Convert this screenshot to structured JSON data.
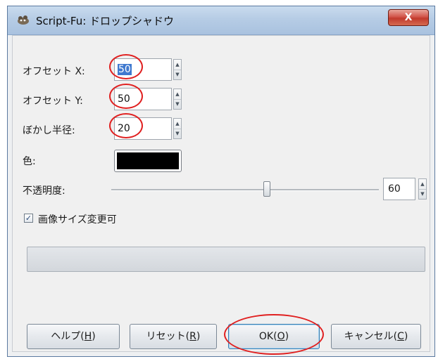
{
  "window": {
    "title": "Script-Fu: ドロップシャドウ",
    "close_label": "X",
    "app_icon": "gimp-icon"
  },
  "fields": {
    "offset_x": {
      "label": "オフセット X:",
      "value": "50"
    },
    "offset_y": {
      "label": "オフセット Y:",
      "value": "50"
    },
    "blur_radius": {
      "label": "ぼかし半径:",
      "value": "20"
    },
    "color": {
      "label": "色:",
      "value": "#000000"
    },
    "opacity": {
      "label": "不透明度:",
      "value": "60",
      "slider_fraction": 0.6
    },
    "allow_resize": {
      "label": "画像サイズ変更可",
      "checked": true
    }
  },
  "buttons": {
    "help": {
      "text": "ヘルプ(",
      "mnemonic": "H",
      "close": ")"
    },
    "reset": {
      "text": "リセット(",
      "mnemonic": "R",
      "close": ")"
    },
    "ok": {
      "text": "OK(",
      "mnemonic": "O",
      "close": ")"
    },
    "cancel": {
      "text": "キャンセル(",
      "mnemonic": "C",
      "close": ")"
    }
  },
  "annotation_color": "#e02020"
}
